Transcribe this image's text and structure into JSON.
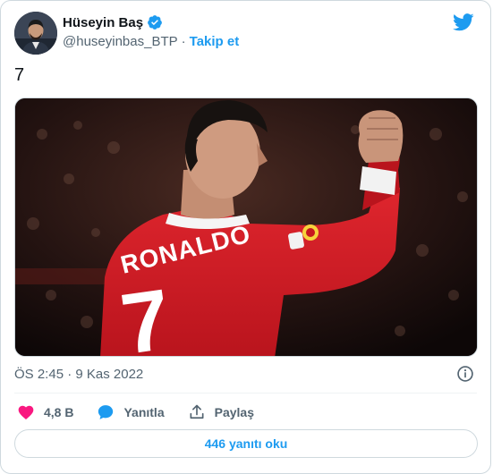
{
  "author": {
    "name": "Hüseyin Baş",
    "handle": "@huseyinbas_BTP",
    "separator": "·",
    "follow_label": "Takip et"
  },
  "tweet": {
    "text": "7",
    "image_jersey_name": "RONALDO",
    "image_jersey_number": "7",
    "timestamp": "ÖS 2:45 · 9 Kas 2022"
  },
  "actions": {
    "likes": "4,8 B",
    "reply_label": "Yanıtla",
    "share_label": "Paylaş"
  },
  "replies_button": "446 yanıtı oku",
  "colors": {
    "accent": "#1d9bf0",
    "like": "#f91880",
    "secondary_text": "#536471",
    "jersey_red": "#d4202c"
  },
  "icons": {
    "verified": "verified-badge-icon",
    "logo": "twitter-bird-icon",
    "info": "info-icon",
    "like": "heart-icon",
    "reply": "speech-bubble-icon",
    "share": "share-upload-icon"
  }
}
